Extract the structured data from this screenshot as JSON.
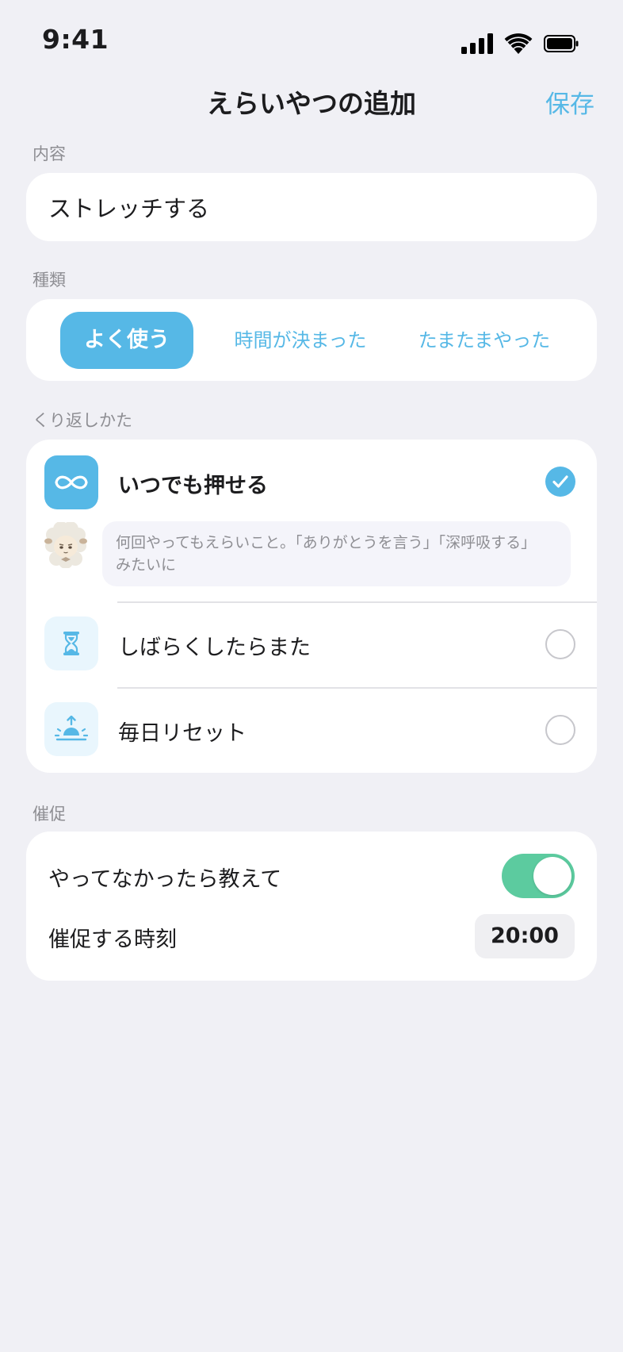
{
  "status_bar": {
    "time": "9:41"
  },
  "nav": {
    "title": "えらいやつの追加",
    "save_label": "保存"
  },
  "content_section": {
    "label": "内容",
    "value": "ストレッチする"
  },
  "kind_section": {
    "label": "種類",
    "options": [
      "よく使う",
      "時間が決まった",
      "たまたまやった"
    ],
    "selected": "よく使う"
  },
  "repeat_section": {
    "label": "くり返しかた",
    "options": [
      {
        "label": "いつでも押せる",
        "icon": "infinity-icon",
        "selected": true
      },
      {
        "label": "しばらくしたらまた",
        "icon": "hourglass-icon",
        "selected": false
      },
      {
        "label": "毎日リセット",
        "icon": "sunrise-icon",
        "selected": false
      }
    ],
    "hint_lines": [
      "何回やってもえらいこと。「ありがとうを言う」「深呼吸する」",
      "みたいに"
    ]
  },
  "reminder_section": {
    "label": "催促",
    "notify_label": "やってなかったら教えて",
    "notify_on": true,
    "time_label": "催促する時刻",
    "time_value": "20:00"
  },
  "colors": {
    "accent": "#56b8e6",
    "toggle_on": "#5ccb9f",
    "background": "#f0f0f5",
    "card": "#ffffff",
    "secondary_text": "#8e8e93"
  }
}
